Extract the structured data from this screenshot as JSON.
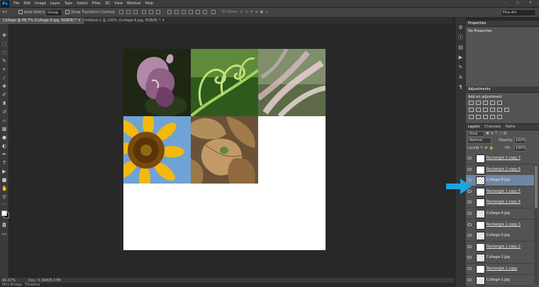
{
  "menu": {
    "logo": "Ps",
    "items": [
      "File",
      "Edit",
      "Image",
      "Layer",
      "Type",
      "Select",
      "Filter",
      "3D",
      "View",
      "Window",
      "Help"
    ],
    "window_controls": "– ▢ ✕"
  },
  "options": {
    "auto_select_label": "Auto-Select:",
    "auto_select_value": "Group",
    "transform_label": "Show Transform Controls",
    "mode_label": "3D Mode:",
    "workspace": "Fine Art"
  },
  "tabs": [
    {
      "label": "Collage @ 66.7% (Collage-6.jpg, RGB/8) * ×"
    },
    {
      "label": "Untitled-1 @ 100% (Collage-6.jpg, RGB/8) * ×"
    }
  ],
  "status": {
    "zoom": "66.67%",
    "doc": "Doc: 3.34M/8.37M"
  },
  "bottom_tabs": [
    "Mini Bridge",
    "Timeline"
  ],
  "properties": {
    "tab": "Properties",
    "message": "No Properties"
  },
  "adjustments": {
    "tab": "Adjustments",
    "hint": "Add an adjustment"
  },
  "layers": {
    "tabs": [
      "Layers",
      "Channels",
      "Paths"
    ],
    "kind": "Kind",
    "blend_mode": "Normal",
    "opacity_label": "Opacity:",
    "opacity_value": "100%",
    "lock_label": "Lock:",
    "fill_label": "Fill:",
    "fill_value": "100%",
    "rows": [
      {
        "name": "Rectangle 1 copy 7",
        "selected": false,
        "pixel": false
      },
      {
        "name": "Rectangle 1 copy 6",
        "selected": false,
        "pixel": false
      },
      {
        "name": "Collage-6.jpg",
        "selected": true,
        "pixel": true
      },
      {
        "name": "Rectangle 1 copy 5",
        "selected": false,
        "pixel": false
      },
      {
        "name": "Rectangle 1 copy 4",
        "selected": false,
        "pixel": false
      },
      {
        "name": "Collage-4.jpg",
        "selected": false,
        "pixel": true
      },
      {
        "name": "Rectangle 1 copy 3",
        "selected": false,
        "pixel": false
      },
      {
        "name": "Collage-3.jpg",
        "selected": false,
        "pixel": true
      },
      {
        "name": "Rectangle 1 copy 2",
        "selected": false,
        "pixel": false
      },
      {
        "name": "Collage-2.jpg",
        "selected": false,
        "pixel": true
      },
      {
        "name": "Rectangle 1 copy",
        "selected": false,
        "pixel": false
      },
      {
        "name": "Collage-1.jpg",
        "selected": false,
        "pixel": true
      }
    ]
  },
  "colors": {
    "arrow": "#1fa3e0",
    "selected_layer": "#6e86a3"
  }
}
